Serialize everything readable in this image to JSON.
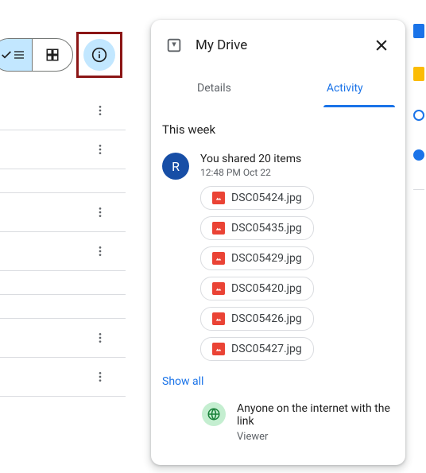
{
  "panel": {
    "title": "My Drive",
    "tabs": {
      "details": "Details",
      "activity": "Activity"
    },
    "section_header": "This week",
    "avatar_initial": "R",
    "activity_title": "You shared 20 items",
    "activity_time": "12:48 PM Oct 22",
    "files": [
      "DSC05424.jpg",
      "DSC05435.jpg",
      "DSC05429.jpg",
      "DSC05420.jpg",
      "DSC05426.jpg",
      "DSC05427.jpg"
    ],
    "show_all": "Show all",
    "share_text": "Anyone on the internet with the link",
    "share_role": "Viewer"
  }
}
